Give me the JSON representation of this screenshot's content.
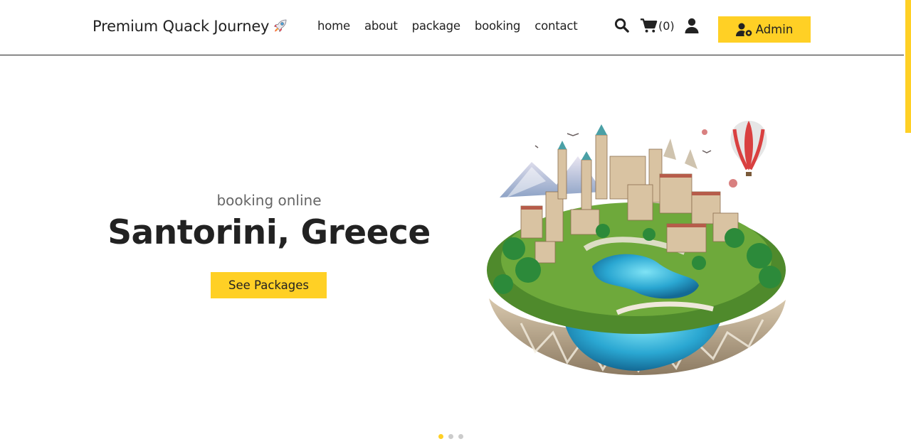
{
  "brand": {
    "name": "Premium Quack Journey",
    "icon": "rocket-icon"
  },
  "nav": {
    "items": [
      "home",
      "about",
      "package",
      "booking",
      "contact"
    ]
  },
  "header_icons": {
    "search": "search-icon",
    "cart": "cart-icon",
    "cart_count": "(0)",
    "user": "user-icon"
  },
  "admin_button": {
    "label": "Admin",
    "icon": "user-cog-icon"
  },
  "hero": {
    "subtitle": "booking online",
    "title": "Santorini, Greece",
    "cta_label": "See Packages",
    "image": "floating-island-city-illustration"
  },
  "carousel": {
    "slides": 3,
    "active": 0
  },
  "colors": {
    "accent": "#ffd025",
    "text": "#222222",
    "muted": "#666666",
    "dot_inactive": "#cccccc"
  }
}
